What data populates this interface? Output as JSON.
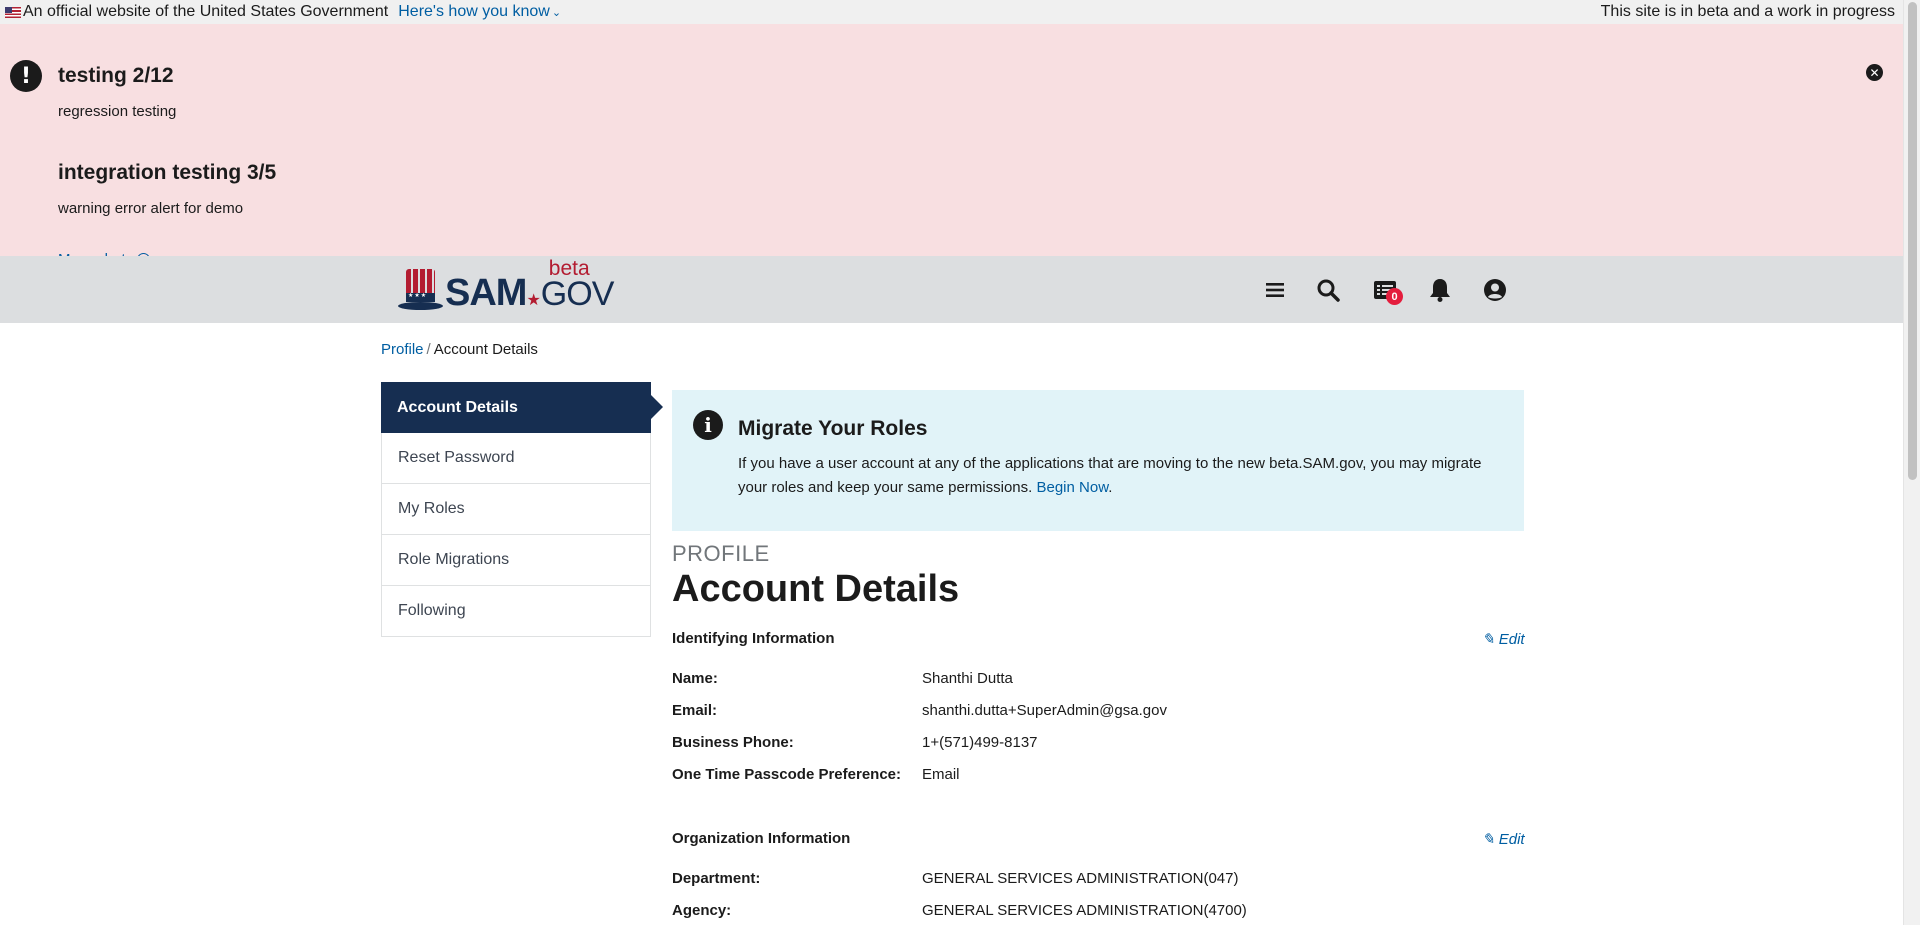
{
  "gov_banner": {
    "official_text": "An official website of the United States Government",
    "how_link": "Here's how you know",
    "beta_notice": "This site is in beta and a work in progress"
  },
  "alerts": [
    {
      "title": "testing 2/12",
      "body": "regression testing"
    },
    {
      "title": "integration testing 3/5",
      "body": "warning error alert for demo"
    }
  ],
  "more_alerts_label": "More alerts",
  "logo": {
    "sam": "SAM",
    "beta": "beta",
    "gov": "GOV"
  },
  "header": {
    "icons": [
      "menu-icon",
      "search-icon",
      "messages-icon",
      "notifications-icon",
      "user-account-icon"
    ],
    "message_count": "0"
  },
  "breadcrumb": {
    "parent": "Profile",
    "separator": "/",
    "current": "Account Details"
  },
  "sidenav": {
    "items": [
      {
        "label": "Account Details",
        "active": true
      },
      {
        "label": "Reset Password"
      },
      {
        "label": "My Roles"
      },
      {
        "label": "Role Migrations"
      },
      {
        "label": "Following"
      }
    ]
  },
  "migrate_box": {
    "title": "Migrate Your Roles",
    "body": "If you have a user account at any of the applications that are moving to the new beta.SAM.gov, you may migrate your roles and keep your same permissions.",
    "link": "Begin Now",
    "trailing": "."
  },
  "page": {
    "eyebrow": "PROFILE",
    "title": "Account Details"
  },
  "identifying": {
    "heading": "Identifying Information",
    "edit": "Edit",
    "fields": [
      {
        "label": "Name:",
        "value": "Shanthi Dutta"
      },
      {
        "label": "Email:",
        "value": "shanthi.dutta+SuperAdmin@gsa.gov"
      },
      {
        "label": "Business Phone:",
        "value": "1+(571)499-8137"
      },
      {
        "label": "One Time Passcode Preference:",
        "value": "Email"
      }
    ]
  },
  "organization": {
    "heading": "Organization Information",
    "edit": "Edit",
    "fields": [
      {
        "label": "Department:",
        "value": "GENERAL SERVICES ADMINISTRATION(047)"
      },
      {
        "label": "Agency:",
        "value": "GENERAL SERVICES ADMINISTRATION(4700)"
      }
    ]
  },
  "colors": {
    "alert_bg": "#f8dfe1",
    "header_bg": "#dcdee0",
    "nav_active": "#162e51",
    "link": "#005ea2",
    "info_bg": "#e1f3f8",
    "logo_red": "#b31c31"
  }
}
